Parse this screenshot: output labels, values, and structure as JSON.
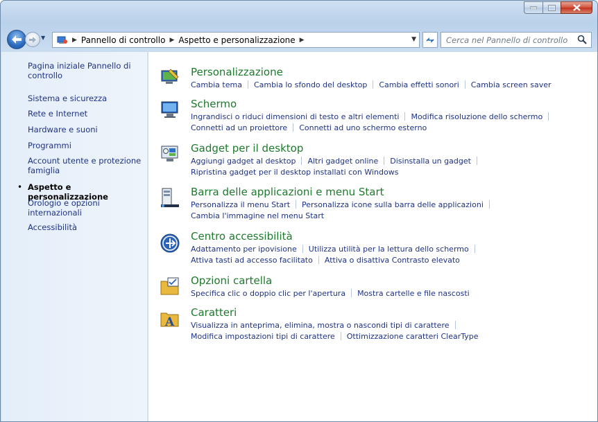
{
  "window": {
    "title_buttons": {
      "minimize": "minimize-icon",
      "maximize": "maximize-icon",
      "close": "close-icon"
    }
  },
  "nav": {
    "breadcrumbs": [
      "Pannello di controllo",
      "Aspetto e personalizzazione"
    ],
    "search_placeholder": "Cerca nel Pannello di controllo"
  },
  "sidebar": {
    "items": [
      {
        "label": "Pagina iniziale Pannello di controllo"
      },
      {
        "label": "Sistema e sicurezza"
      },
      {
        "label": "Rete e Internet"
      },
      {
        "label": "Hardware e suoni"
      },
      {
        "label": "Programmi"
      },
      {
        "label": "Account utente e protezione famiglia"
      },
      {
        "label": "Aspetto e personalizzazione"
      },
      {
        "label": "Orologio e opzioni internazionali"
      },
      {
        "label": "Accessibilità"
      }
    ]
  },
  "categories": [
    {
      "title": "Personalizzazione",
      "icon": "personalization-icon",
      "lines": [
        [
          "Cambia tema",
          "Cambia lo sfondo del desktop",
          "Cambia effetti sonori",
          "Cambia screen saver"
        ]
      ]
    },
    {
      "title": "Schermo",
      "icon": "display-icon",
      "lines": [
        [
          "Ingrandisci o riduci dimensioni di testo e altri elementi",
          "Modifica risoluzione dello schermo"
        ],
        [
          "Connetti ad un proiettore",
          "Connetti ad uno schermo esterno"
        ]
      ]
    },
    {
      "title": "Gadget per il desktop",
      "icon": "gadget-icon",
      "lines": [
        [
          "Aggiungi gadget al desktop",
          "Altri gadget online",
          "Disinstalla un gadget"
        ],
        [
          "Ripristina gadget per il desktop installati con Windows"
        ]
      ]
    },
    {
      "title": "Barra delle applicazioni e menu Start",
      "icon": "taskbar-icon",
      "lines": [
        [
          "Personalizza il menu Start",
          "Personalizza icone sulla barra delle applicazioni"
        ],
        [
          "Cambia l'immagine nel menu Start"
        ]
      ]
    },
    {
      "title": "Centro accessibilità",
      "icon": "accessibility-icon",
      "lines": [
        [
          "Adattamento per ipovisione",
          "Utilizza utilità per la lettura dello schermo"
        ],
        [
          "Attiva tasti ad accesso facilitato",
          "Attiva o disattiva Contrasto elevato"
        ]
      ]
    },
    {
      "title": "Opzioni cartella",
      "icon": "folder-options-icon",
      "lines": [
        [
          "Specifica clic o doppio clic per l'apertura",
          "Mostra cartelle e file nascosti"
        ]
      ]
    },
    {
      "title": "Caratteri",
      "icon": "fonts-icon",
      "lines": [
        [
          "Visualizza in anteprima, elimina, mostra o nascondi tipi di carattere"
        ],
        [
          "Modifica impostazioni tipi di carattere",
          "Ottimizzazione caratteri ClearType"
        ]
      ]
    }
  ],
  "colors": {
    "link": "#1e3287",
    "category_title": "#1e7a2c"
  }
}
